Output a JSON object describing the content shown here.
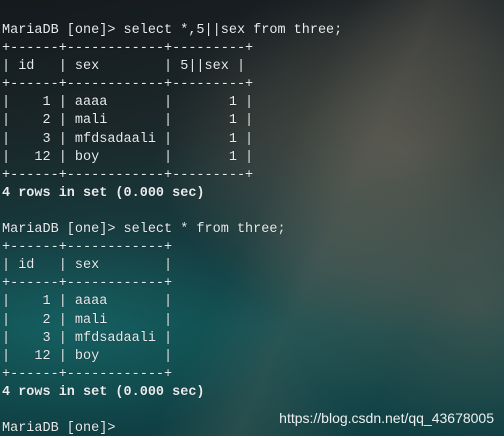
{
  "terminal": {
    "lines": [
      "MariaDB [one]> select *,5||sex from three;",
      "+------+------------+---------+",
      "| id   | sex        | 5||sex |",
      "+------+------------+---------+",
      "|    1 | aaaa       |       1 |",
      "|    2 | mali       |       1 |",
      "|    3 | mfdsadaali |       1 |",
      "|   12 | boy        |       1 |",
      "+------+------------+---------+",
      "4 rows in set (0.000 sec)",
      "",
      "MariaDB [one]> select * from three;",
      "+------+------------+",
      "| id   | sex        |",
      "+------+------------+",
      "|    1 | aaaa       |",
      "|    2 | mali       |",
      "|    3 | mfdsadaali |",
      "|   12 | boy        |",
      "+------+------------+",
      "4 rows in set (0.000 sec)",
      "",
      "MariaDB [one]> "
    ]
  },
  "watermark": "https://blog.csdn.net/qq_43678005"
}
